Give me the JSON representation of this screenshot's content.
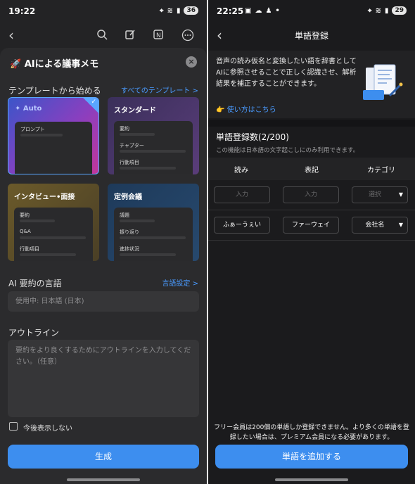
{
  "left": {
    "status": {
      "time": "19:22",
      "battery": "36"
    },
    "sheet": {
      "title": "🚀 AIによる議事メモ",
      "templates_heading": "テンプレートから始める",
      "all_templates_link": "すべてのテンプレート >",
      "templates": [
        {
          "name": "✦ Auto",
          "rows": [
            "プロンプト"
          ],
          "selected": true
        },
        {
          "name": "スタンダード",
          "rows": [
            "要約",
            "チャプター",
            "行動項目"
          ],
          "selected": false
        },
        {
          "name": "インタビュー•面接",
          "rows": [
            "要約",
            "Q&A",
            "行動項目"
          ],
          "selected": false
        },
        {
          "name": "定例会議",
          "rows": [
            "議題",
            "振り返り",
            "進捗状況"
          ],
          "selected": false
        }
      ],
      "language_heading": "AI 要約の言語",
      "language_link": "言語設定 >",
      "language_value": "使用中: 日本語 (日本)",
      "outline_heading": "アウトライン",
      "outline_placeholder": "要約をより良くするためにアウトラインを入力してください。（任意）",
      "dont_show_label": "今後表示しない",
      "generate_button": "生成"
    }
  },
  "right": {
    "status": {
      "time": "22:25",
      "battery": "29"
    },
    "header_title": "単語登録",
    "info_text": "音声の読み仮名と変換したい語を辞書としてAIに参照させることで正しく認識させ、解析結果を補正することができます。",
    "how_to_link": "👉 使い方はこちら",
    "count_label": "単語登録数(2/200)",
    "count_note": "この機能は日本語の文字起こしにのみ利用できます。",
    "columns": [
      "読み",
      "表記",
      "カテゴリ"
    ],
    "input_row": {
      "reading_placeholder": "入力",
      "notation_placeholder": "入力",
      "category_placeholder": "選択"
    },
    "entries": [
      {
        "reading": "ふぁーうぇい",
        "notation": "ファーウェイ",
        "category": "会社名"
      }
    ],
    "bottom_note": "フリー会員は200個の単語しか登録できません。より多くの単語を登録したい場合は、プレミアム会員になる必要があります。",
    "add_button": "単語を追加する"
  },
  "colors": {
    "accent": "#3d8eef",
    "link": "#4a9bff"
  }
}
